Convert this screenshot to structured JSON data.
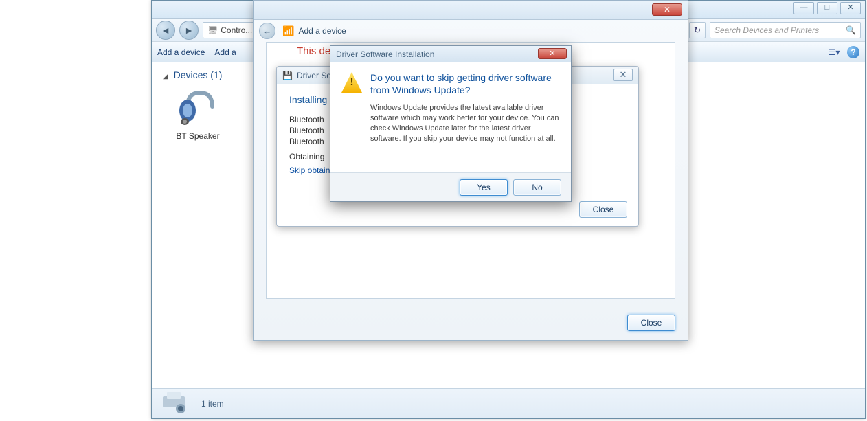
{
  "explorer": {
    "breadcrumb": "Contro...",
    "search_placeholder": "Search Devices and Printers",
    "toolbar": {
      "add_device": "Add a device",
      "add_partial": "Add a"
    },
    "section": {
      "title": "Devices",
      "count": "(1)"
    },
    "device": {
      "label": "BT Speaker"
    },
    "status": {
      "text": "1 item"
    }
  },
  "wizard": {
    "title": "Add a device",
    "heading_cut": "This devic",
    "close_label": "Close"
  },
  "driver": {
    "title": "Driver So",
    "heading": "Installing",
    "items": [
      "Bluetooth",
      "Bluetooth",
      "Bluetooth"
    ],
    "obtaining": "Obtaining",
    "skip_link": "Skip obtain",
    "close_label": "Close"
  },
  "confirm": {
    "title": "Driver Software Installation",
    "heading": "Do you want to skip getting driver software from Windows Update?",
    "body": "Windows Update provides the latest available driver software which may work better for your device.  You can check Windows Update later for the latest driver software.  If you skip your device may not function at all.",
    "yes": "Yes",
    "no": "No"
  }
}
